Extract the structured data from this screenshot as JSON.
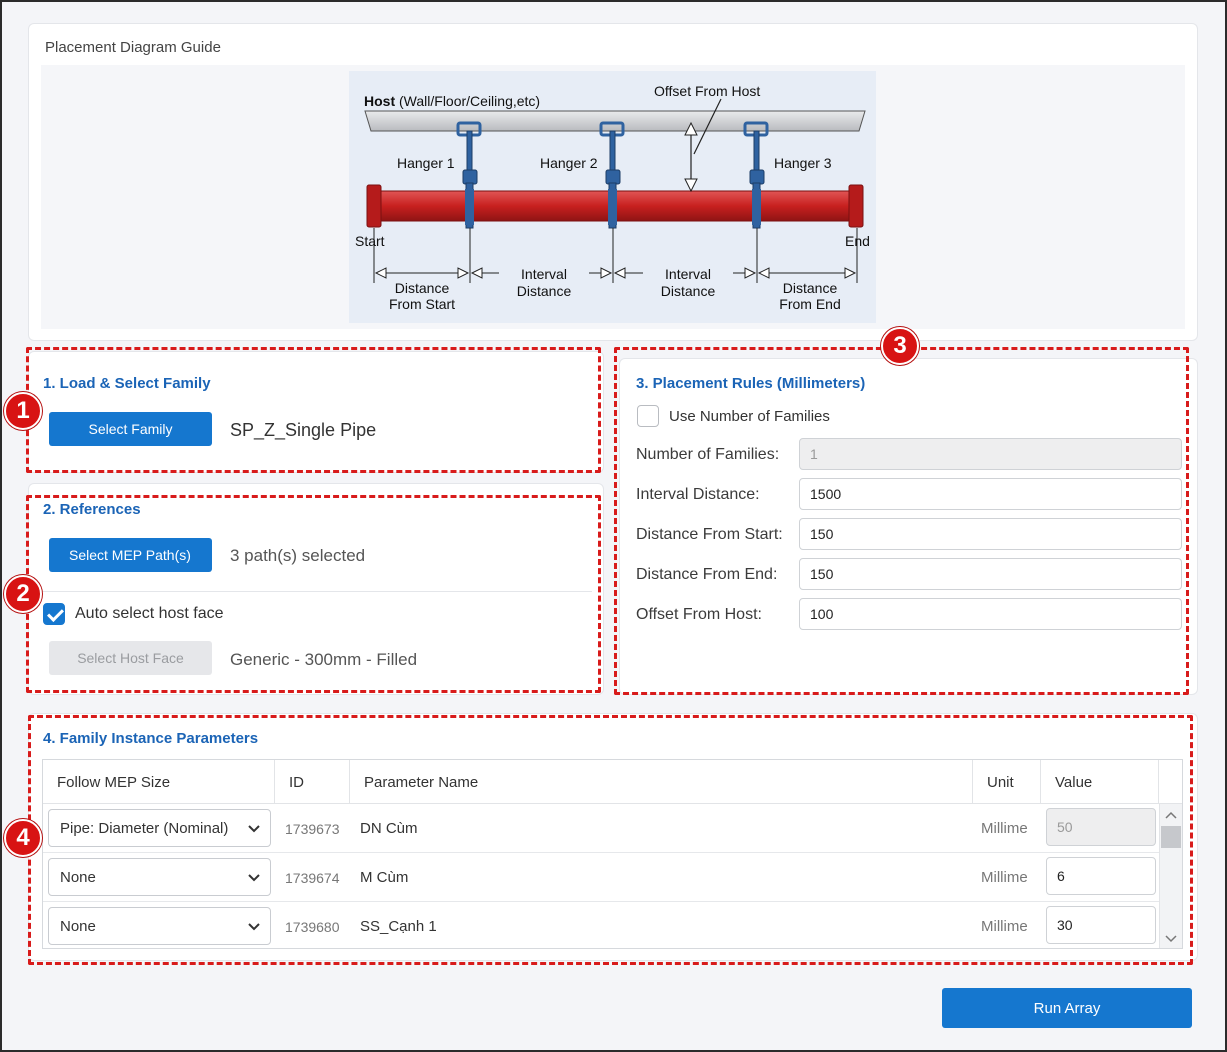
{
  "diagram_guide": {
    "title": "Placement Diagram Guide",
    "host_bold": "Host",
    "host_rest": "(Wall/Floor/Ceiling,etc)",
    "offset_label": "Offset From Host",
    "hanger1": "Hanger 1",
    "hanger2": "Hanger 2",
    "hanger3": "Hanger 3",
    "start": "Start",
    "end": "End",
    "dist_start_1": "Distance",
    "dist_start_2": "From Start",
    "interval_1": "Interval",
    "interval_2": "Distance",
    "dist_end_1": "Distance",
    "dist_end_2": "From End"
  },
  "badges": [
    "1",
    "2",
    "3",
    "4"
  ],
  "section1": {
    "title": "1. Load & Select Family",
    "button": "Select Family",
    "family_name": "SP_Z_Single Pipe"
  },
  "section2": {
    "title": "2. References",
    "mep_button": "Select MEP Path(s)",
    "paths_selected": "3 path(s) selected",
    "auto_host_label": "Auto select host face",
    "auto_host_checked": true,
    "host_face_button": "Select Host Face",
    "host_face_value": "Generic - 300mm - Filled"
  },
  "section3": {
    "title": "3. Placement Rules (Millimeters)",
    "use_number_label": "Use Number of Families",
    "use_number_checked": false,
    "fields": [
      {
        "label": "Number of Families:",
        "value": "1",
        "disabled": true
      },
      {
        "label": "Interval Distance:",
        "value": "1500",
        "disabled": false
      },
      {
        "label": "Distance From Start:",
        "value": "150",
        "disabled": false
      },
      {
        "label": "Distance From End:",
        "value": "150",
        "disabled": false
      },
      {
        "label": "Offset From Host:",
        "value": "100",
        "disabled": false
      }
    ]
  },
  "section4": {
    "title": "4. Family Instance Parameters",
    "columns": [
      "Follow MEP Size",
      "ID",
      "Parameter Name",
      "Unit",
      "Value"
    ],
    "rows": [
      {
        "follow": "Pipe: Diameter (Nominal)",
        "id": "1739673",
        "name": "DN Cùm",
        "unit": "Millime",
        "value": "50",
        "disabled": true
      },
      {
        "follow": "None",
        "id": "1739674",
        "name": "M Cùm",
        "unit": "Millime",
        "value": "6",
        "disabled": false
      },
      {
        "follow": "None",
        "id": "1739680",
        "name": "SS_Cạnh 1",
        "unit": "Millime",
        "value": "30",
        "disabled": false
      }
    ]
  },
  "run_button": "Run Array",
  "colors": {
    "accent": "#1577cf",
    "title_blue": "#1b64b6",
    "annotation_red": "#d81b1b",
    "pipe_red": "#c8201f",
    "hanger_blue": "#2f62a0"
  }
}
